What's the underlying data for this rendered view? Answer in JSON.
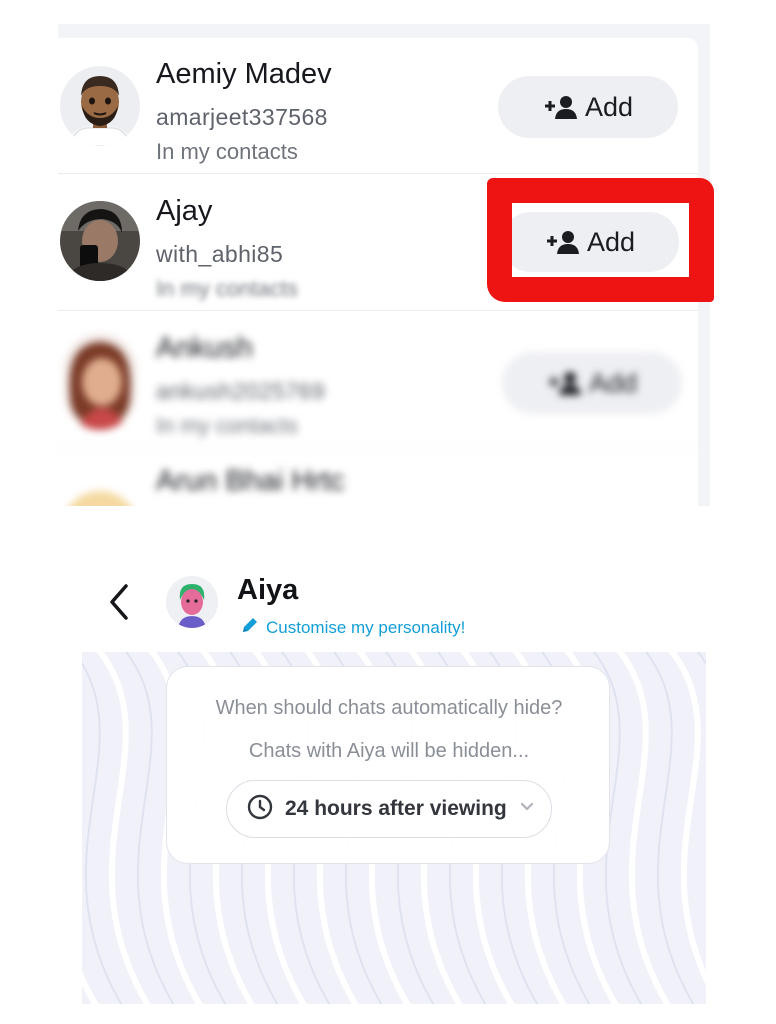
{
  "contacts": [
    {
      "name": "Aemiy Madev",
      "username": "amarjeet337568",
      "subtitle": "In my contacts",
      "add_label": "Add"
    },
    {
      "name": "Ajay",
      "username": "with_abhi85",
      "subtitle": "In my contacts",
      "add_label": "Add"
    },
    {
      "name": "Ankush",
      "username": "ankush2025769",
      "subtitle": "In my contacts",
      "add_label": "Add"
    },
    {
      "name": "Arun Bhai Hrtc"
    }
  ],
  "highlight_color": "#ef1414",
  "chat": {
    "name": "Aiya",
    "customise_label": "Customise my personality!",
    "accent_color": "#149ed8",
    "hide_question": "When should chats automatically hide?",
    "hide_info": "Chats with Aiya will be hidden...",
    "hide_option": "24 hours after viewing"
  },
  "icons": [
    "add-friend-icon",
    "back-chevron-icon",
    "pencil-icon",
    "clock-icon",
    "chevron-down-icon"
  ]
}
